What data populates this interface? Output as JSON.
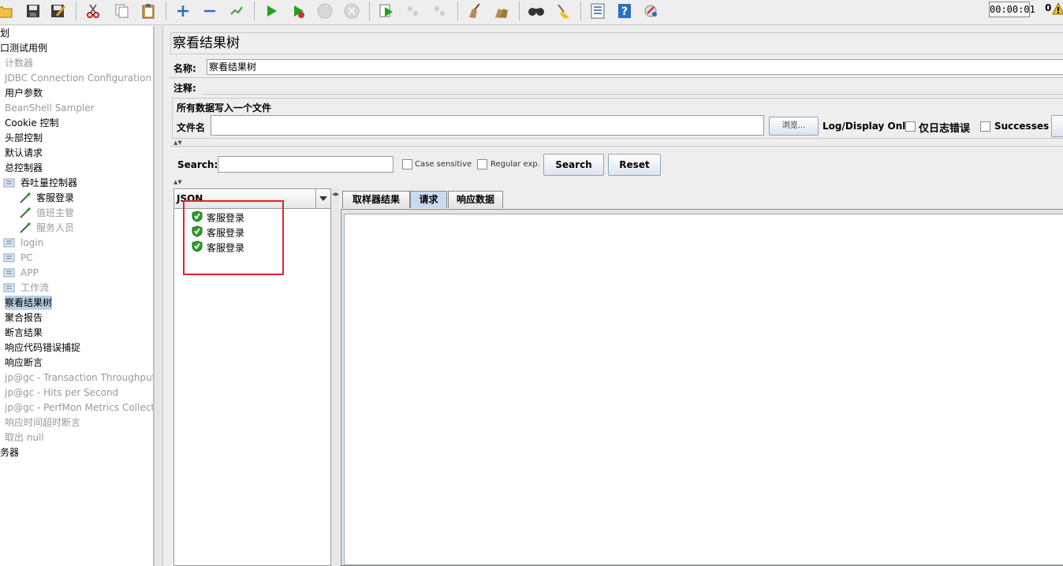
{
  "toolbar": {
    "timer": "00:00:01",
    "error_count": "0"
  },
  "tree": {
    "items": [
      {
        "label": "划",
        "indent": 0,
        "disabled": false,
        "icon": "plan-icon"
      },
      {
        "label": "口测试用例",
        "indent": 0,
        "disabled": false,
        "icon": "thread-group-icon"
      },
      {
        "label": "计数器",
        "indent": 6,
        "disabled": true,
        "icon": "config-icon"
      },
      {
        "label": "JDBC Connection Configuration",
        "indent": 6,
        "disabled": true,
        "icon": "config-icon"
      },
      {
        "label": "用户参数",
        "indent": 6,
        "disabled": false,
        "icon": "config-icon"
      },
      {
        "label": "BeanShell Sampler",
        "indent": 6,
        "disabled": true,
        "icon": "sampler-icon"
      },
      {
        "label": "Cookie 控制",
        "indent": 6,
        "disabled": false,
        "icon": "config-icon"
      },
      {
        "label": "头部控制",
        "indent": 6,
        "disabled": false,
        "icon": "config-icon"
      },
      {
        "label": "默认请求",
        "indent": 6,
        "disabled": false,
        "icon": "config-icon"
      },
      {
        "label": "总控制器",
        "indent": 6,
        "disabled": false,
        "icon": "controller-icon"
      },
      {
        "label": "吞吐量控制器",
        "indent": 26,
        "disabled": false,
        "icon": "controller-icon"
      },
      {
        "label": "客服登录",
        "indent": 46,
        "disabled": false,
        "icon": "pipette-icon"
      },
      {
        "label": "值班主管",
        "indent": 46,
        "disabled": true,
        "icon": "pipette-icon"
      },
      {
        "label": "服务人员",
        "indent": 46,
        "disabled": true,
        "icon": "pipette-icon"
      },
      {
        "label": "login",
        "indent": 26,
        "disabled": true,
        "icon": "controller-icon"
      },
      {
        "label": "PC",
        "indent": 26,
        "disabled": true,
        "icon": "controller-icon"
      },
      {
        "label": "APP",
        "indent": 26,
        "disabled": true,
        "icon": "controller-icon"
      },
      {
        "label": "工作流",
        "indent": 26,
        "disabled": true,
        "icon": "controller-icon"
      },
      {
        "label": "察看结果树",
        "indent": 6,
        "disabled": false,
        "selected": true,
        "icon": "listener-icon"
      },
      {
        "label": "聚合报告",
        "indent": 6,
        "disabled": false,
        "icon": "listener-icon"
      },
      {
        "label": "断言结果",
        "indent": 6,
        "disabled": false,
        "icon": "listener-icon"
      },
      {
        "label": "响应代码错误捕捉",
        "indent": 6,
        "disabled": false,
        "icon": "assertion-icon"
      },
      {
        "label": "响应断言",
        "indent": 6,
        "disabled": false,
        "icon": "assertion-icon"
      },
      {
        "label": "jp@gc - Transaction Throughput vs",
        "indent": 6,
        "disabled": true,
        "icon": "listener-icon"
      },
      {
        "label": "jp@gc - Hits per Second",
        "indent": 6,
        "disabled": true,
        "icon": "listener-icon"
      },
      {
        "label": "jp@gc - PerfMon Metrics Collector",
        "indent": 6,
        "disabled": true,
        "icon": "listener-icon"
      },
      {
        "label": "响应时间超时断言",
        "indent": 6,
        "disabled": true,
        "icon": "assertion-icon"
      },
      {
        "label": "取出 null",
        "indent": 6,
        "disabled": true,
        "icon": "extractor-icon"
      },
      {
        "label": "务器",
        "indent": 0,
        "disabled": false,
        "icon": "server-icon"
      }
    ]
  },
  "panel": {
    "title": "察看结果树",
    "name_label": "名称:",
    "name_value": "察看结果树",
    "comment_label": "注释:",
    "file_group_title": "所有数据写入一个文件",
    "filename_label": "文件名",
    "browse_label": "浏览...",
    "log_display_label": "Log/Display Only:",
    "errors_only_label": "仅日志错误",
    "successes_label": "Successes"
  },
  "search": {
    "label": "Search:",
    "case_sensitive_label": "Case sensitive",
    "regex_label": "Regular exp.",
    "search_button": "Search",
    "reset_button": "Reset"
  },
  "results": {
    "renderer": "JSON",
    "items": [
      "客服登录",
      "客服登录",
      "客服登录"
    ]
  },
  "tabs": [
    {
      "label": "取样器结果",
      "active": false
    },
    {
      "label": "请求",
      "active": true
    },
    {
      "label": "响应数据",
      "active": false
    }
  ],
  "colors": {
    "highlight": "#e0242e",
    "selection": "#b8cfe5",
    "success": "#2e9e2e"
  }
}
